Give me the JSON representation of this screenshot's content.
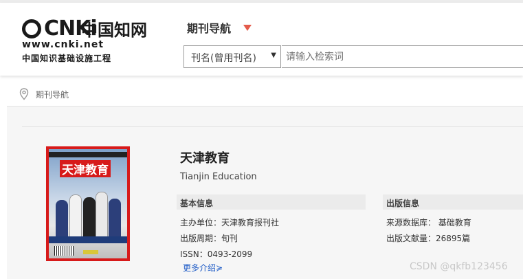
{
  "header": {
    "logo_cnki": "CNKi",
    "logo_cn": "中国知网",
    "logo_url": "www.cnki.net",
    "logo_sub": "中国知识基础设施工程",
    "nav_title": "期刊导航",
    "accent": "#e45b4b"
  },
  "search": {
    "select_value": "刊名(曾用刊名)",
    "placeholder": "请输入检索词"
  },
  "breadcrumb": {
    "label": "期刊导航"
  },
  "journal": {
    "cover_title": "天津教育",
    "title": "天津教育",
    "title_en": "Tianjin Education"
  },
  "basic_info": {
    "heading": "基本信息",
    "sponsor": "主办单位：天津教育报刊社",
    "frequency": "出版周期：旬刊",
    "issn": "ISSN：0493-2099",
    "more": "更多介绍"
  },
  "pub_info": {
    "heading": "出版信息",
    "source_db": "来源数据库：  基础教育",
    "doc_count": "出版文献量：26895篇"
  },
  "watermark": "CSDN @qkfb123456"
}
